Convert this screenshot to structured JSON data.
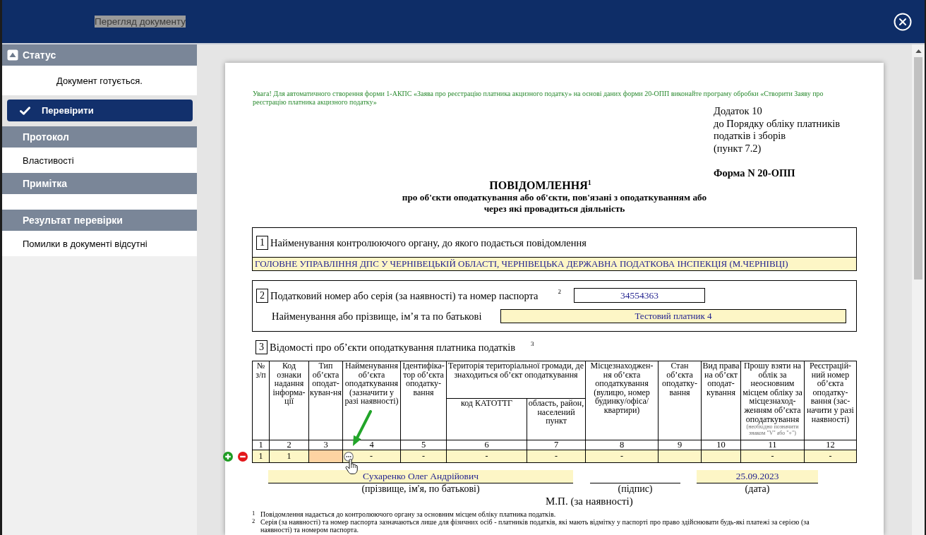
{
  "window": {
    "title": "Перегляд документу",
    "title_highlighted": true
  },
  "sidebar": {
    "items": [
      {
        "kind": "toggle",
        "label": "Статус",
        "expanded": true
      },
      {
        "kind": "status",
        "text": "Документ готується."
      },
      {
        "kind": "button",
        "label": "Перевірити"
      },
      {
        "kind": "header",
        "label": "Протокол"
      },
      {
        "kind": "link",
        "label": "Властивості"
      },
      {
        "kind": "header",
        "label": "Примітка"
      },
      {
        "kind": "blank"
      },
      {
        "kind": "header",
        "label": "Результат перевірки"
      },
      {
        "kind": "text",
        "text": "Помилки в документі відсутні"
      }
    ]
  },
  "document": {
    "notice": "Увага! Для автоматичного створення форми 1-АКПС «Заява про реєстрацію платника акцизного податку» на основі даних форми 20-ОПП виконайте програму обробки «Створити Заяву про реєстрацію платника акцизного податку»",
    "appendix_lines": [
      "Додаток 10",
      "до Порядку обліку платників",
      "податків і зборів",
      "(пункт 7.2)"
    ],
    "form_number": "Форма N 20-ОПП",
    "title": "ПОВІДОМЛЕННЯ$^{1}$",
    "subtitle_lines": [
      "про об'єкти оподаткування або об'єкти, пов'язані з оподаткуванням або",
      "через які провадиться діяльність"
    ],
    "section_1": {
      "number": "1",
      "label": "Найменування контролюючого органу, до якого подається повідомлення",
      "value": "ГОЛОВНЕ УПРАВЛІННЯ ДПС У ЧЕРНІВЕЦЬКІЙ ОБЛАСТІ, ЧЕРНІВЕЦЬКА ДЕРЖАВНА ПОДАТКОВА ІНСПЕКЦІЯ (М.ЧЕРНІВЦІ)"
    },
    "section_2": {
      "number": "2",
      "label": "Податковий номер або серія (за наявності) та номер паспорта",
      "footnote": "2",
      "tax_number": "34554363",
      "name_label": "Найменування або прізвище, ім’я та по батькові",
      "name_value": "Тестовий платник 4"
    },
    "section_3": {
      "number": "3",
      "label": "Відомості про об’єкти оподаткування платника податків",
      "footnote": "3"
    },
    "table": {
      "columns": [
        {
          "kind": "single",
          "heading": "№ з/п"
        },
        {
          "kind": "single",
          "heading": "Код ознаки надання інформа-ції"
        },
        {
          "kind": "single",
          "heading": "Тип об’єкта оподат-куван-ня"
        },
        {
          "kind": "single",
          "heading": "Найменування об’єкта оподаткування (зазначити у разі наявності)"
        },
        {
          "kind": "single",
          "heading": "Ідентифіка-тор об’єкта оподатку-вання"
        },
        {
          "kind": "group",
          "heading": "Територія територіальної громади, де знаходиться об’єкт оподаткування",
          "colspan": 2,
          "children": [
            {
              "heading": "код КАТОТТГ"
            },
            {
              "heading": "область, район, населений пункт"
            }
          ]
        },
        {
          "kind": "single",
          "heading": "Місцезнаходжен-ня об’єкта оподаткування (вулицю, номер будинку/офіса/ квартири)"
        },
        {
          "kind": "single",
          "heading": "Стан об’єкта оподатку-вання"
        },
        {
          "kind": "single",
          "heading": "Вид права на об’єкт оподат-кування"
        },
        {
          "kind": "single",
          "heading": "Прошу взяти на облік за неосновним місцем обліку за місцезнаход-женням об’єкта оподаткування",
          "note": "(необхідно позначити знаком \"V\" або \"+\")"
        },
        {
          "kind": "single",
          "heading": "Реєстрацій-ний номер об’єкта оподатку-вання (зас-начити у разі наявності)"
        }
      ],
      "column_numbers": [
        "1",
        "2",
        "3",
        "4",
        "5",
        "6",
        "7",
        "8",
        "9",
        "10",
        "11",
        "12"
      ],
      "rows": [
        {
          "cells": [
            {
              "kind": "text",
              "value": "1"
            },
            {
              "kind": "text",
              "value": "1"
            },
            {
              "kind": "required"
            },
            {
              "kind": "picker",
              "value": "-"
            },
            {
              "kind": "text",
              "value": "-"
            },
            {
              "kind": "text",
              "value": "-"
            },
            {
              "kind": "text",
              "value": "-"
            },
            {
              "kind": "text",
              "value": "-"
            },
            {
              "kind": "empty"
            },
            {
              "kind": "empty"
            },
            {
              "kind": "text",
              "value": "-"
            },
            {
              "kind": "text",
              "value": "-"
            }
          ]
        }
      ]
    },
    "signature": {
      "name": "Сухаренко Олег Андрійович",
      "name_caption": "(прізвище, ім'я, по батькові)",
      "signature_caption": "(підпис)",
      "date": "25.09.2023",
      "date_caption": "(дата)"
    },
    "stamp": "М.П. (за наявності)",
    "footnotes": [
      {
        "mark": "1",
        "text": "Повідомлення надається до контролюючого органу за основним місцем обліку платника податків."
      },
      {
        "mark": "2",
        "text": "Серія (за наявності) та номер паспорта зазначаються лише для фізичних осіб - платників податків, які мають відмітку у паспорті про право здійснювати будь-які платежі за серією (за наявності) та номером паспорта."
      }
    ]
  }
}
